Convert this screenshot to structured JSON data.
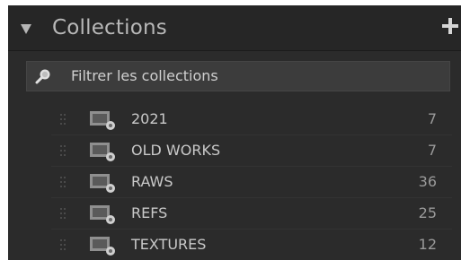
{
  "header": {
    "title": "Collections",
    "collapse_icon": "triangle-down-icon",
    "add_icon": "plus-icon"
  },
  "filter": {
    "placeholder": "Filtrer les collections",
    "icon": "search-icon"
  },
  "collections": [
    {
      "name": "2021",
      "count": "7"
    },
    {
      "name": "OLD WORKS",
      "count": "7"
    },
    {
      "name": "RAWS",
      "count": "36"
    },
    {
      "name": "REFS",
      "count": "25"
    },
    {
      "name": "TEXTURES",
      "count": "12"
    }
  ],
  "colors": {
    "panel_bg": "#2a2a2a",
    "header_bg": "#262626",
    "filter_bg": "#3c3c3c",
    "text": "#c9c9c9",
    "count_text": "#9a9a9a"
  }
}
